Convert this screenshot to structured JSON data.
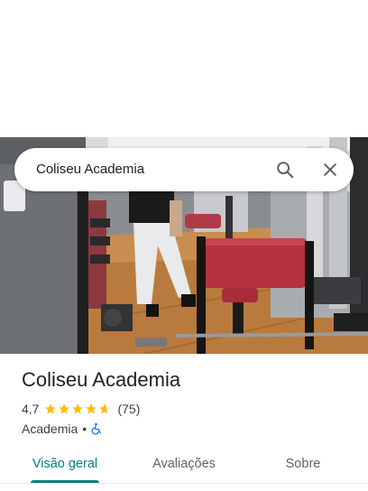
{
  "search": {
    "query": "Coliseu Academia"
  },
  "place": {
    "name": "Coliseu Academia",
    "rating": "4,7",
    "rating_value": 4.7,
    "reviews": "(75)",
    "category": "Academia",
    "separator": "•"
  },
  "tabs": [
    {
      "label": "Visão geral",
      "active": true
    },
    {
      "label": "Avaliações",
      "active": false
    },
    {
      "label": "Sobre",
      "active": false
    }
  ],
  "colors": {
    "accent": "#0b7f84",
    "star": "#fbbc04",
    "accessibility": "#1a73e8"
  },
  "icons": {
    "search": "search-icon",
    "close": "close-icon",
    "accessibility": "wheelchair-icon"
  }
}
